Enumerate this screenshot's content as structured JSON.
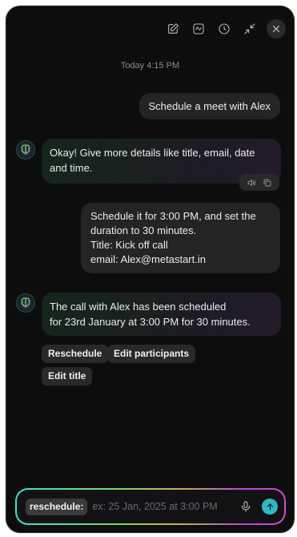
{
  "toolbar": {
    "icons": [
      "edit-icon",
      "summary-icon",
      "history-icon",
      "minimize-icon",
      "close-icon"
    ]
  },
  "chat": {
    "timestamp": "Today 4:15 PM",
    "messages": [
      {
        "role": "user",
        "lines": [
          "Schedule a meet with Alex"
        ]
      },
      {
        "role": "assistant",
        "lines": [
          "Okay! Give more details like title, email, date",
          "and time."
        ]
      },
      {
        "role": "user",
        "lines": [
          "Schedule it for 3:00 PM, and set the",
          "duration to 30 minutes.",
          "Title: Kick off call",
          "email: Alex@metastart.in"
        ]
      },
      {
        "role": "assistant",
        "lines": [
          "The call with Alex has been scheduled",
          "for 23rd January at 3:00 PM for 30 minutes."
        ]
      }
    ],
    "message_actions": [
      "speaker-icon",
      "copy-icon"
    ],
    "suggestions": [
      "Reschedule",
      "Edit participants",
      "Edit title"
    ]
  },
  "composer": {
    "command_tag": "reschedule:",
    "value": "",
    "placeholder": "ex: 25 Jan, 2025 at 3:00 PM"
  },
  "colors": {
    "background": "#0d0d0e",
    "user_bubble": "#242427",
    "send_button": "#2fb8c6",
    "accent_gradient": [
      "#38e0c8",
      "#7cd85a",
      "#b04ad9"
    ]
  }
}
